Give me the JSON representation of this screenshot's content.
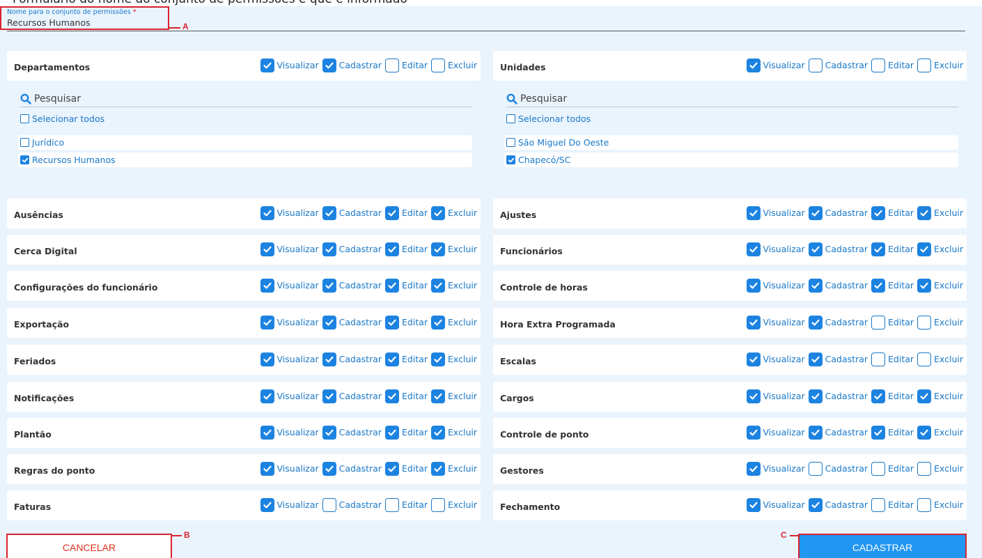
{
  "form": {
    "name_label": "Nome para o conjunto de permissões",
    "required_mark": "*",
    "name_value": "Recursos Humanos",
    "top_partial_text": "Formulário do nome do conjunto de permissões e que é informado"
  },
  "perm_labels": [
    "Visualizar",
    "Cadastrar",
    "Editar",
    "Excluir"
  ],
  "left_permissions": [
    {
      "name": "Departamentos",
      "checks": [
        true,
        true,
        false,
        false
      ]
    },
    {
      "name": "Ausências",
      "checks": [
        true,
        true,
        true,
        true
      ]
    },
    {
      "name": "Cerca Digital",
      "checks": [
        true,
        true,
        true,
        true
      ]
    },
    {
      "name": "Configurações do funcionário",
      "checks": [
        true,
        true,
        true,
        true
      ]
    },
    {
      "name": "Exportação",
      "checks": [
        true,
        true,
        true,
        true
      ]
    },
    {
      "name": "Feriados",
      "checks": [
        true,
        true,
        true,
        true
      ]
    },
    {
      "name": "Notificações",
      "checks": [
        true,
        true,
        true,
        true
      ]
    },
    {
      "name": "Plantão",
      "checks": [
        true,
        true,
        true,
        true
      ]
    },
    {
      "name": "Regras do ponto",
      "checks": [
        true,
        true,
        true,
        true
      ]
    },
    {
      "name": "Faturas",
      "checks": [
        true,
        false,
        false,
        false
      ]
    }
  ],
  "right_permissions": [
    {
      "name": "Unidades",
      "checks": [
        true,
        false,
        false,
        false
      ]
    },
    {
      "name": "Ajustes",
      "checks": [
        true,
        true,
        true,
        true
      ]
    },
    {
      "name": "Funcionários",
      "checks": [
        true,
        true,
        true,
        true
      ]
    },
    {
      "name": "Controle de horas",
      "checks": [
        true,
        true,
        true,
        true
      ]
    },
    {
      "name": "Hora Extra Programada",
      "checks": [
        true,
        true,
        false,
        false
      ]
    },
    {
      "name": "Escalas",
      "checks": [
        true,
        true,
        false,
        false
      ]
    },
    {
      "name": "Cargos",
      "checks": [
        true,
        true,
        true,
        true
      ]
    },
    {
      "name": "Controle de ponto",
      "checks": [
        true,
        true,
        true,
        true
      ]
    },
    {
      "name": "Gestores",
      "checks": [
        true,
        false,
        false,
        false
      ]
    },
    {
      "name": "Fechamento",
      "checks": [
        true,
        true,
        false,
        false
      ]
    }
  ],
  "departments_panel": {
    "search_placeholder": "Pesquisar",
    "select_all_label": "Selecionar todos",
    "select_all_checked": false,
    "items": [
      {
        "label": "Jurídico",
        "checked": false
      },
      {
        "label": "Recursos Humanos",
        "checked": true
      }
    ]
  },
  "units_panel": {
    "search_placeholder": "Pesquisar",
    "select_all_label": "Selecionar todos",
    "select_all_checked": false,
    "items": [
      {
        "label": "São Miguel Do Oeste",
        "checked": false
      },
      {
        "label": "Chapecó/SC",
        "checked": true
      }
    ]
  },
  "buttons": {
    "cancel": "CANCELAR",
    "submit": "CADASTRAR"
  },
  "annotations": {
    "a": "A",
    "b": "B",
    "c": "C"
  },
  "colors": {
    "background": "#eaf4fd",
    "accent_blue": "#1c83e1",
    "submit_blue": "#2196f3",
    "annotation_red": "#d9232e",
    "cancel_text": "#e0301e"
  }
}
